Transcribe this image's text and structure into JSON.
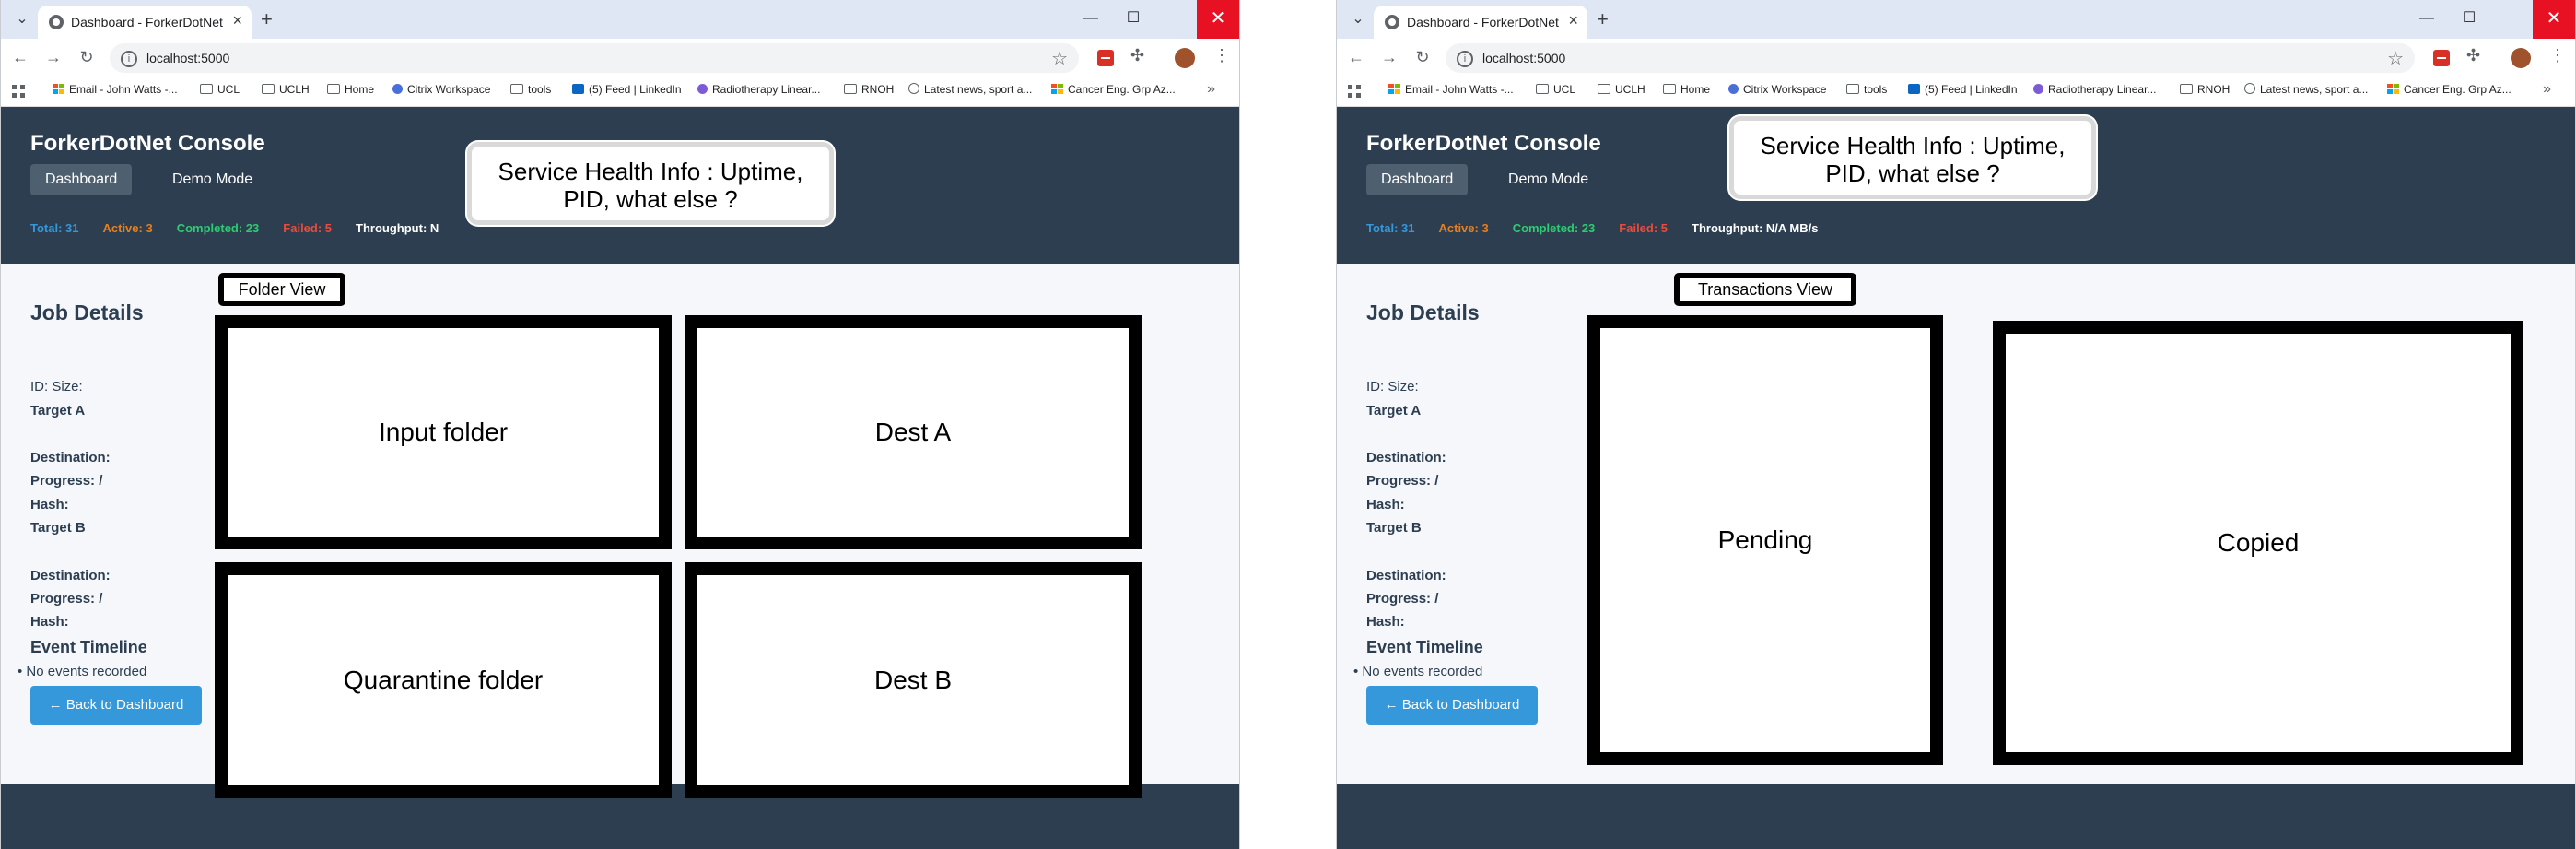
{
  "browser": {
    "tab_title": "Dashboard - ForkerDotNet Con",
    "url": "localhost:5000",
    "bookmarks": [
      "Email - John Watts -...",
      "UCL",
      "UCLH",
      "Home",
      "Citrix Workspace",
      "tools",
      "(5) Feed | LinkedIn",
      "Radiotherapy Linear...",
      "RNOH",
      "Latest news, sport a...",
      "Cancer Eng. Grp Az..."
    ]
  },
  "app": {
    "title": "ForkerDotNet Console",
    "nav": [
      "Dashboard",
      "Demo Mode"
    ],
    "stats": {
      "total": "Total: 31",
      "active": "Active: 3",
      "completed": "Completed: 23",
      "failed": "Failed: 5",
      "throughput": "Throughput: N/A MB/s",
      "throughput_partial": "Throughput: N"
    },
    "colors": {
      "total": "#3498db",
      "active": "#e67e22",
      "completed": "#2ecc71",
      "failed": "#e74c3c"
    }
  },
  "details": {
    "heading": "Job Details",
    "id_size": "ID: Size:",
    "target_a": "Target A",
    "destination": "Destination:",
    "progress": "Progress: /",
    "hash": "Hash:",
    "target_b": "Target B",
    "timeline_heading": "Event Timeline",
    "no_events": "No events recorded",
    "back_button": "← Back to Dashboard"
  },
  "annotations": {
    "service_health": "Service Health Info : Uptime, PID, what else ?",
    "folder_view": "Folder View",
    "transactions_view": "Transactions View",
    "input_folder": "Input folder",
    "dest_a": "Dest A",
    "quarantine_folder": "Quarantine folder",
    "dest_b": "Dest B",
    "pending": "Pending",
    "copied": "Copied"
  }
}
